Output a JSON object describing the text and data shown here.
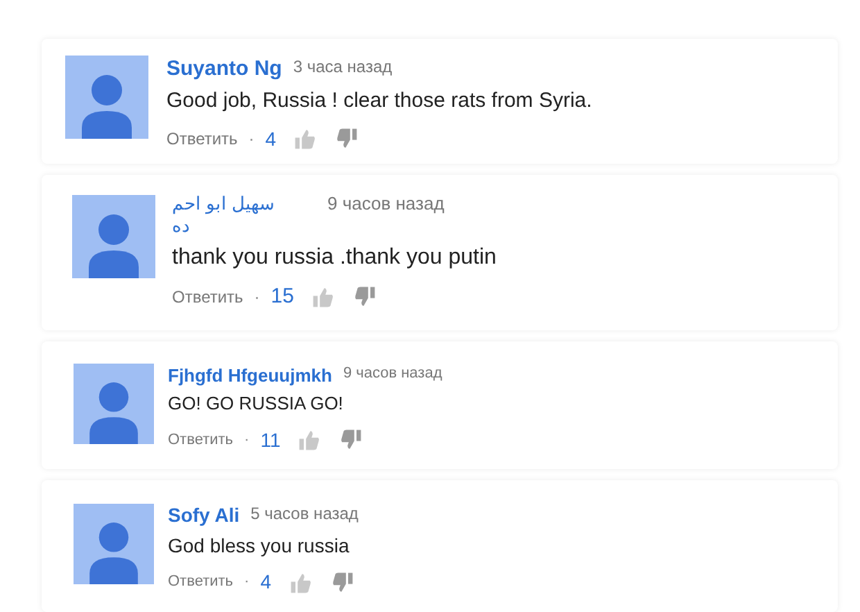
{
  "comments": [
    {
      "author": "Suyanto Ng",
      "time": "3 часа назад",
      "text": "Good job, Russia ! clear those rats from Syria.",
      "reply": "Ответить",
      "separator": "·",
      "likes": "4"
    },
    {
      "author": "سهيل ابو احم ده",
      "time": "9 часов назад",
      "text": "thank you russia .thank you putin",
      "reply": "Ответить",
      "separator": "·",
      "likes": "15"
    },
    {
      "author": "Fjhgfd Hfgeuujmkh",
      "time": "9 часов назад",
      "text": "GO! GO RUSSIA GO!",
      "reply": "Ответить",
      "separator": "·",
      "likes": "11"
    },
    {
      "author": "Sofy Ali",
      "time": "5 часов назад",
      "text": "God bless you russia",
      "reply": "Ответить",
      "separator": "·",
      "likes": "4"
    }
  ]
}
